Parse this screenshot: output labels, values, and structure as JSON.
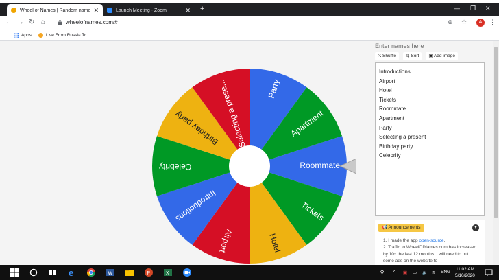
{
  "browser": {
    "tabs": [
      {
        "title": "Wheel of Names | Random name",
        "active": true
      },
      {
        "title": "Launch Meeting - Zoom",
        "active": false
      }
    ],
    "url": "wheelofnames.com/#",
    "avatar_letter": "A",
    "bookmarks": [
      "Apps",
      "Live From Russia Tr..."
    ]
  },
  "wheel": {
    "segments": [
      "Roommate",
      "Tickets",
      "Hotel",
      "Airport",
      "Introductions",
      "Celebrity",
      "Birthday party",
      "Selecting a prese...",
      "Party",
      "Apartment"
    ],
    "colors": [
      "#3369e8",
      "#009925",
      "#eeb211",
      "#d50f25"
    ]
  },
  "panel": {
    "title": "Enter names here",
    "shuffle_label": "Shuffle",
    "sort_label": "Sort",
    "add_image_label": "Add image",
    "names": [
      "Introductions",
      "Airport",
      "Hotel",
      "Tickets",
      "Roommate",
      "Apartment",
      "Party",
      "Selecting a present",
      "Birthday party",
      "Celebrity"
    ]
  },
  "announcements": {
    "button_label": "Announcements",
    "items": [
      {
        "prefix": "1. I made the app ",
        "link": "open-source",
        "suffix": "."
      },
      {
        "prefix": "2. Traffic to WheelOfNames.com has increased by 10x the last 12 months. I will need to put some ads on the website to",
        "link": "",
        "suffix": ""
      }
    ]
  },
  "taskbar": {
    "lang": "ENG",
    "time": "11:02 AM",
    "date": "5/10/2020"
  }
}
